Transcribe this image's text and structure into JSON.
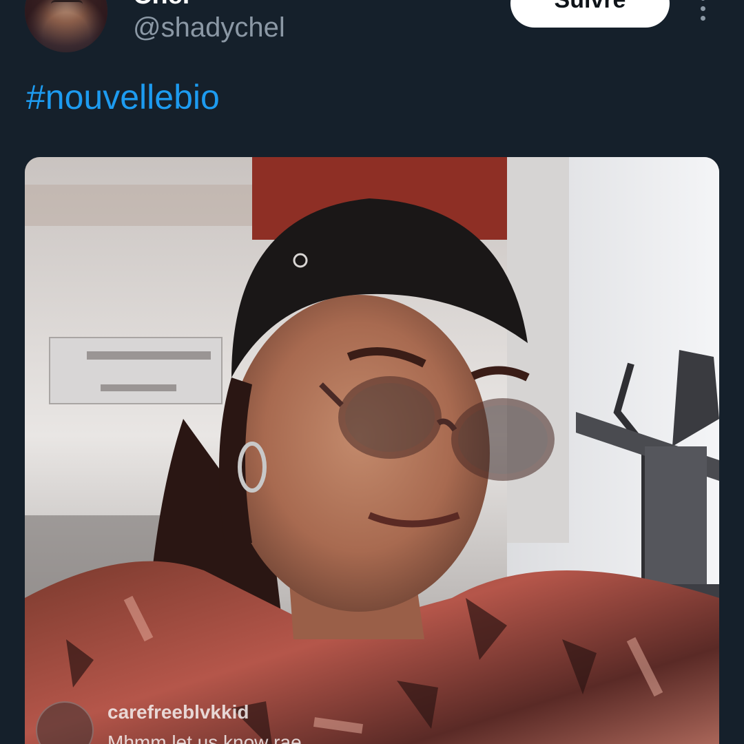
{
  "tweet": {
    "author": {
      "display_name": "Chel",
      "handle": "@shadychel",
      "avatar_icon": "profile-photo"
    },
    "follow_label": "Suivre",
    "more_icon": "more-vertical-icon",
    "text": "#nouvellebio",
    "media": {
      "type": "video-screenshot",
      "overlay_username": "carefreeblvkkid",
      "overlay_message": "Mhmm let us know rae"
    }
  },
  "colors": {
    "background": "#15202b",
    "text_primary": "#ffffff",
    "text_secondary": "#8b98a5",
    "link": "#1d9bf0",
    "button_bg": "#ffffff",
    "button_text": "#0f1419"
  }
}
